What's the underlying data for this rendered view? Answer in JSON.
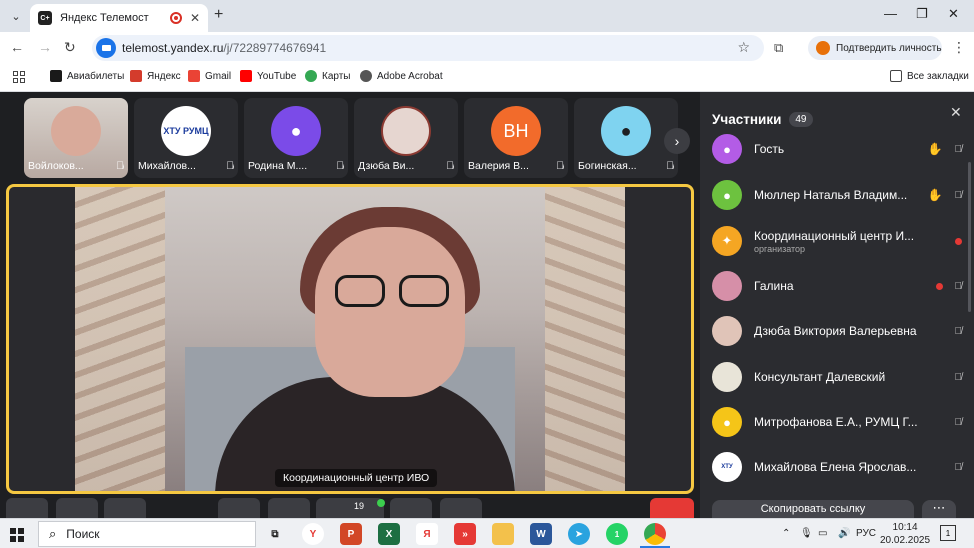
{
  "browser": {
    "tab_title": "Яндекс Телемост",
    "tab_favicon_text": "C+",
    "new_tab": "+",
    "url_host": "telemost.yandex.ru",
    "url_path": "/j/72289774676941",
    "profile_button": "Подтвердить личность",
    "bookmarks": [
      {
        "label": "Авиабилеты",
        "color": "#1a1a1a"
      },
      {
        "label": "Яндекс",
        "color": "#d43c2c"
      },
      {
        "label": "Gmail",
        "color": "#ea4335"
      },
      {
        "label": "YouTube",
        "color": "#ff0000"
      },
      {
        "label": "Карты",
        "color": "#34a853"
      },
      {
        "label": "Adobe Acrobat",
        "color": "#555555"
      }
    ],
    "all_bookmarks": "Все закладки"
  },
  "tiles": [
    {
      "name": "Войлоков...",
      "avatar": "photo",
      "color": "#c9b9b0"
    },
    {
      "name": "Михайлов...",
      "avatar": "logo",
      "color": "#ffffff"
    },
    {
      "name": "Родина М....",
      "avatar": "person",
      "color": "#7b4be8"
    },
    {
      "name": "Дзюба Ви...",
      "avatar": "photo",
      "color": "#e6d6d0"
    },
    {
      "name": "Валерия В...",
      "avatar": "ВН",
      "color": "#f26b2b"
    },
    {
      "name": "Богинская...",
      "avatar": "person",
      "color": "#7fd3f0"
    }
  ],
  "speaker": {
    "label": "Координационный центр ИВО"
  },
  "panel": {
    "title": "Участники",
    "count": "49",
    "participants": [
      {
        "name": "Гость",
        "role": "",
        "avatar": "person",
        "color": "#b35ce6",
        "hand": true,
        "rec": false
      },
      {
        "name": "Мюллер Наталья Владим...",
        "role": "",
        "avatar": "person",
        "color": "#6dc23f",
        "hand": true,
        "rec": false
      },
      {
        "name": "Координационный центр И...",
        "role": "организатор",
        "avatar": "logo",
        "color": "#f5a623",
        "hand": false,
        "rec": true
      },
      {
        "name": "Галина",
        "role": "",
        "avatar": "photo",
        "color": "#d68fa8",
        "hand": false,
        "rec": true
      },
      {
        "name": "Дзюба Виктория Валерьевна",
        "role": "",
        "avatar": "photo",
        "color": "#e0c4b8",
        "hand": false,
        "rec": false
      },
      {
        "name": "Консультант Далевский",
        "role": "",
        "avatar": "photo",
        "color": "#e8e4d8",
        "hand": false,
        "rec": false
      },
      {
        "name": "Митрофанова Е.А., РУМЦ Г...",
        "role": "",
        "avatar": "person",
        "color": "#f5c518",
        "hand": false,
        "rec": false
      },
      {
        "name": "Михайлова Елена Ярослав...",
        "role": "",
        "avatar": "logo",
        "color": "#ffffff",
        "hand": false,
        "rec": false
      }
    ],
    "copy_link": "Скопировать ссылку",
    "more": "⋯"
  },
  "controls": {
    "badge": "19"
  },
  "taskbar": {
    "search_placeholder": "Поиск",
    "lang": "РУС",
    "time": "10:14",
    "date": "20.02.2025",
    "notifications": "1",
    "whatsapp_badge": "1"
  }
}
